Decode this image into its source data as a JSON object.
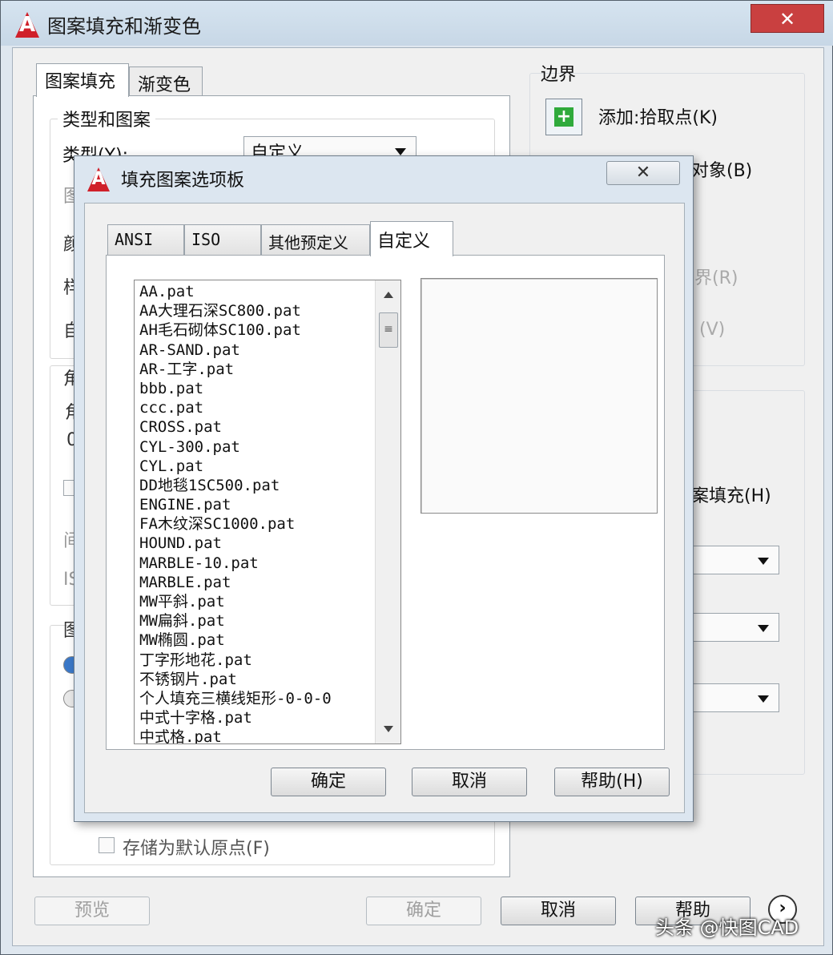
{
  "outer": {
    "title": "图案填充和渐变色",
    "close_label": "✕",
    "tabs": [
      "图案填充",
      "渐变色"
    ],
    "type_group": {
      "title": "类型和图案",
      "type_label": "类型(Y):",
      "type_value": "自定义"
    },
    "origin_checkbox_label": "存储为默认原点(F)",
    "boundary": {
      "title": "边界",
      "add_pick_label": "添加:拾取点(K)",
      "select_objects_fragment": "对象(B)",
      "remove_fragment": "界(R)",
      "view_fragment": "(V)"
    },
    "options_fragment": "案填充(H)",
    "partial_letters": [
      "图",
      "颜",
      "样",
      "自",
      "角",
      "角",
      "0",
      "间",
      "IS",
      "图"
    ],
    "buttons": {
      "preview": "预览",
      "ok": "确定",
      "cancel": "取消",
      "help": "帮助",
      "more": "›"
    }
  },
  "modal": {
    "title": "填充图案选项板",
    "close_label": "✕",
    "tabs": [
      "ANSI",
      "ISO",
      "其他预定义",
      "自定义"
    ],
    "active_tab": "自定义",
    "files": [
      "AA.pat",
      "AA大理石深SC800.pat",
      "AH毛石砌体SC100.pat",
      "AR-SAND.pat",
      "AR-工字.pat",
      "bbb.pat",
      "ccc.pat",
      "CROSS.pat",
      "CYL-300.pat",
      "CYL.pat",
      "DD地毯1SC500.pat",
      "ENGINE.pat",
      "FA木纹深SC1000.pat",
      "HOUND.pat",
      "MARBLE-10.pat",
      "MARBLE.pat",
      "MW平斜.pat",
      "MW扁斜.pat",
      "MW椭圆.pat",
      "丁字形地花.pat",
      "不锈钢片.pat",
      "个人填充三横线矩形-0-0-0",
      "中式十字格.pat",
      "中式格.pat"
    ],
    "buttons": {
      "ok": "确定",
      "cancel": "取消",
      "help": "帮助(H)"
    }
  },
  "watermark": "头条 @快图CAD",
  "colors": {
    "logo_red": "#d0202a",
    "add_green": "#2faa3c"
  }
}
